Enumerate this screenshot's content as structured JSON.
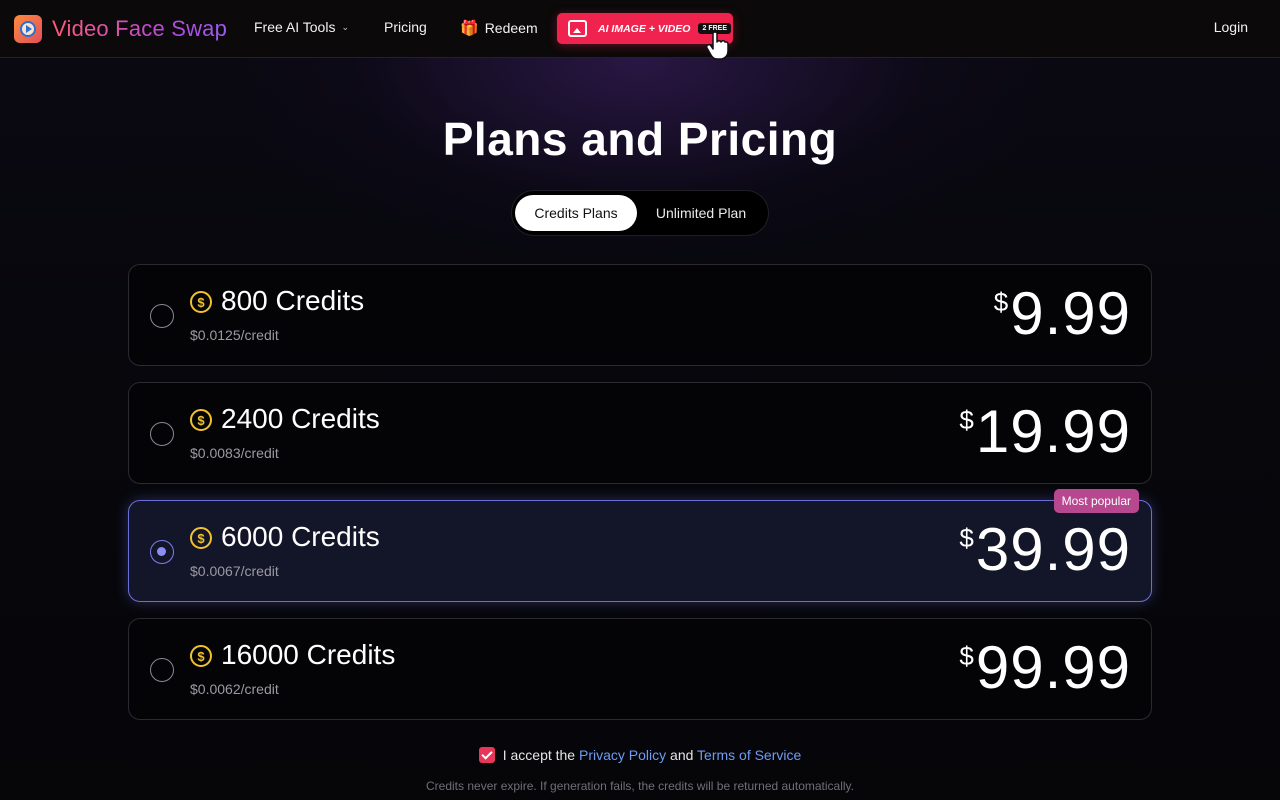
{
  "header": {
    "brand_name": "Video Face Swap",
    "nav": {
      "free_tools": "Free AI Tools",
      "pricing": "Pricing",
      "redeem": "Redeem"
    },
    "promo": {
      "label": "AI IMAGE + VIDEO",
      "badge": "2 FREE"
    },
    "login": "Login"
  },
  "page_title": "Plans and Pricing",
  "toggle": {
    "options": [
      "Credits Plans",
      "Unlimited Plan"
    ],
    "selected": "Credits Plans"
  },
  "plans": [
    {
      "credits": "800 Credits",
      "per_credit": "$0.0125/credit",
      "currency": "$",
      "price": "9.99",
      "selected": false
    },
    {
      "credits": "2400 Credits",
      "per_credit": "$0.0083/credit",
      "currency": "$",
      "price": "19.99",
      "selected": false
    },
    {
      "credits": "6000 Credits",
      "per_credit": "$0.0067/credit",
      "currency": "$",
      "price": "39.99",
      "selected": true,
      "badge": "Most popular"
    },
    {
      "credits": "16000 Credits",
      "per_credit": "$0.0062/credit",
      "currency": "$",
      "price": "99.99",
      "selected": false
    }
  ],
  "consent": {
    "checked": true,
    "prefix": "I accept the",
    "privacy": "Privacy Policy",
    "and": "and",
    "terms": "Terms of Service"
  },
  "note": "Credits never expire. If generation fails, the credits will be returned automatically.",
  "colors": {
    "accent_pink": "#f0234e",
    "selected_border": "#6a6fd8",
    "coin": "#f2c12e",
    "link": "#6f9bf2",
    "badge": "#b7478f"
  },
  "icons": {
    "coin": "dollar-coin-icon",
    "gift": "gift-icon",
    "promo": "image-video-icon",
    "cursor": "hand-pointer-icon"
  }
}
